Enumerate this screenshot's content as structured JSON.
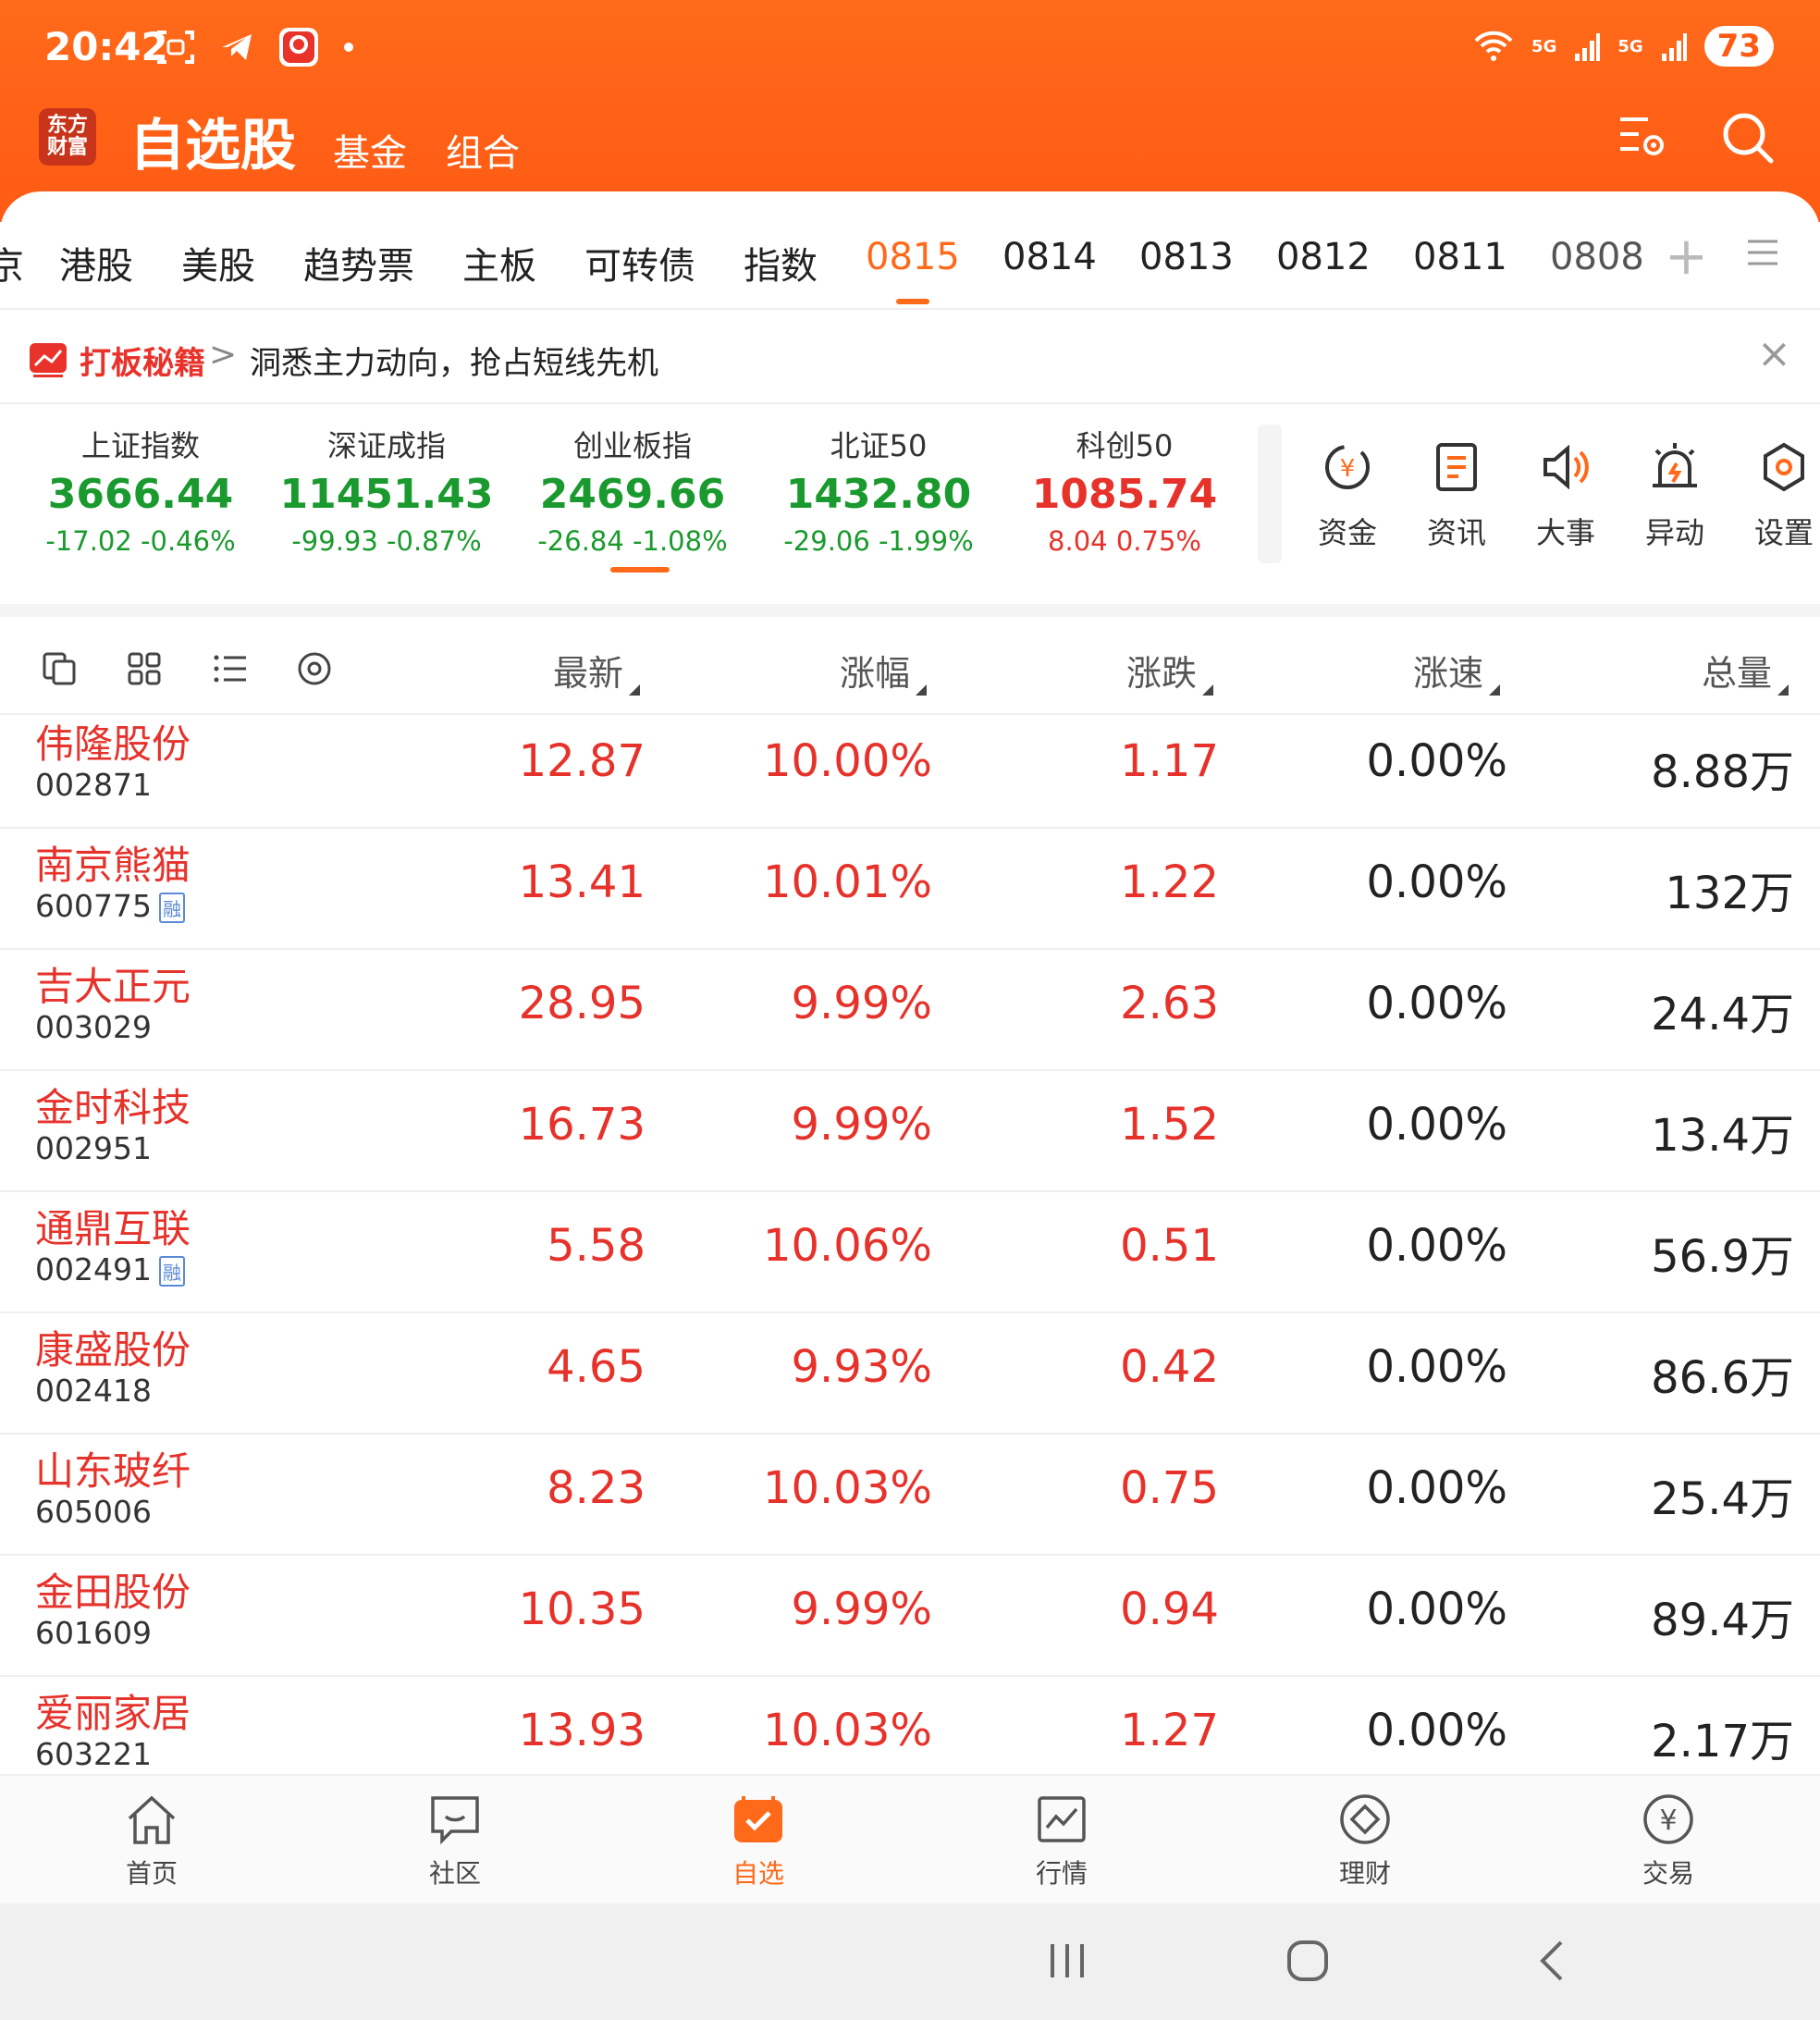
{
  "status": {
    "time": "20:42",
    "battery": "73",
    "signal1": "5G",
    "signal2": "5G"
  },
  "app": {
    "logo_line1": "东方",
    "logo_line2": "财富",
    "title": "自选股",
    "tab_fund": "基金",
    "tab_combo": "组合"
  },
  "group_tabs": [
    "京",
    "港股",
    "美股",
    "趋势票",
    "主板",
    "可转债",
    "指数",
    "0815",
    "0814",
    "0813",
    "0812",
    "0811",
    "0808"
  ],
  "active_group_tab": "0815",
  "promo": {
    "brand": "打板秘籍",
    "arrow": ">",
    "text": "洞悉主力动向，抢占短线先机",
    "close": "×"
  },
  "indices": [
    {
      "name": "上证指数",
      "price": "3666.44",
      "change": "-17.02  -0.46%",
      "trend": "down"
    },
    {
      "name": "深证成指",
      "price": "11451.43",
      "change": "-99.93  -0.87%",
      "trend": "down"
    },
    {
      "name": "创业板指",
      "price": "2469.66",
      "change": "-26.84  -1.08%",
      "trend": "down"
    },
    {
      "name": "北证50",
      "price": "1432.80",
      "change": "-29.06  -1.99%",
      "trend": "down"
    },
    {
      "name": "科创50",
      "price": "1085.74",
      "change": "8.04  0.75%",
      "trend": "up"
    }
  ],
  "quick_actions": [
    {
      "label": "资金",
      "icon": "fund-flow-icon"
    },
    {
      "label": "资讯",
      "icon": "news-icon"
    },
    {
      "label": "大事",
      "icon": "speaker-icon"
    },
    {
      "label": "异动",
      "icon": "alarm-icon"
    },
    {
      "label": "设置",
      "icon": "settings-icon"
    }
  ],
  "columns": [
    "最新",
    "涨幅",
    "涨跌",
    "涨速",
    "总量"
  ],
  "stocks": [
    {
      "name": "伟隆股份",
      "code": "002871",
      "margin": false,
      "price": "12.87",
      "pct": "10.00%",
      "chg": "1.17",
      "speed": "0.00%",
      "vol": "8.88万"
    },
    {
      "name": "南京熊猫",
      "code": "600775",
      "margin": true,
      "price": "13.41",
      "pct": "10.01%",
      "chg": "1.22",
      "speed": "0.00%",
      "vol": "132万"
    },
    {
      "name": "吉大正元",
      "code": "003029",
      "margin": false,
      "price": "28.95",
      "pct": "9.99%",
      "chg": "2.63",
      "speed": "0.00%",
      "vol": "24.4万"
    },
    {
      "name": "金时科技",
      "code": "002951",
      "margin": false,
      "price": "16.73",
      "pct": "9.99%",
      "chg": "1.52",
      "speed": "0.00%",
      "vol": "13.4万"
    },
    {
      "name": "通鼎互联",
      "code": "002491",
      "margin": true,
      "price": "5.58",
      "pct": "10.06%",
      "chg": "0.51",
      "speed": "0.00%",
      "vol": "56.9万"
    },
    {
      "name": "康盛股份",
      "code": "002418",
      "margin": false,
      "price": "4.65",
      "pct": "9.93%",
      "chg": "0.42",
      "speed": "0.00%",
      "vol": "86.6万"
    },
    {
      "name": "山东玻纤",
      "code": "605006",
      "margin": false,
      "price": "8.23",
      "pct": "10.03%",
      "chg": "0.75",
      "speed": "0.00%",
      "vol": "25.4万"
    },
    {
      "name": "金田股份",
      "code": "601609",
      "margin": false,
      "price": "10.35",
      "pct": "9.99%",
      "chg": "0.94",
      "speed": "0.00%",
      "vol": "89.4万"
    },
    {
      "name": "爱丽家居",
      "code": "603221",
      "margin": false,
      "price": "13.93",
      "pct": "10.03%",
      "chg": "1.27",
      "speed": "0.00%",
      "vol": "2.17万"
    }
  ],
  "margin_label": "融",
  "bottom_nav": [
    {
      "label": "首页",
      "icon": "home-icon"
    },
    {
      "label": "社区",
      "icon": "community-icon"
    },
    {
      "label": "自选",
      "icon": "watchlist-icon",
      "active": true
    },
    {
      "label": "行情",
      "icon": "market-icon"
    },
    {
      "label": "理财",
      "icon": "wealth-icon"
    },
    {
      "label": "交易",
      "icon": "trade-icon"
    }
  ],
  "colors": {
    "brand_orange": "#ff6a1a",
    "up_red": "#e6322a",
    "down_green": "#1a9a2e"
  }
}
